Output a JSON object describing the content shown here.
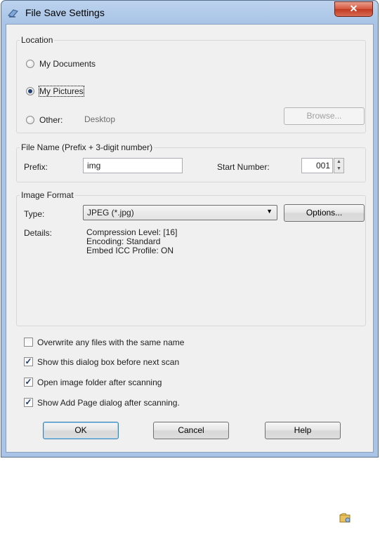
{
  "window": {
    "title": "File Save Settings",
    "close_label": "✕"
  },
  "location": {
    "group_label": "Location",
    "options": [
      {
        "label": "My Documents",
        "checked": false
      },
      {
        "label": "My Pictures",
        "checked": true
      },
      {
        "label": "Other:",
        "checked": false
      }
    ],
    "other_path": "Desktop",
    "browse_label": "Browse..."
  },
  "file_name": {
    "group_label": "File Name (Prefix + 3-digit number)",
    "prefix_label": "Prefix:",
    "prefix_value": "img",
    "start_number_label": "Start Number:",
    "start_number_value": "001"
  },
  "image_format": {
    "group_label": "Image Format",
    "type_label": "Type:",
    "type_value": "JPEG (*.jpg)",
    "options_label": "Options...",
    "details_label": "Details:",
    "details_lines": [
      "Compression Level: [16]",
      "Encoding: Standard",
      "Embed ICC Profile: ON"
    ]
  },
  "checkboxes": [
    {
      "label": "Overwrite any files with the same name",
      "checked": false
    },
    {
      "label": "Show this dialog box before next scan",
      "checked": true
    },
    {
      "label": "Open image folder after scanning",
      "checked": true
    },
    {
      "label": "Show Add Page dialog after scanning.",
      "checked": true
    }
  ],
  "buttons": {
    "ok": "OK",
    "cancel": "Cancel",
    "help": "Help"
  },
  "icons": {
    "app": "scanner-app-icon",
    "corner": "folder-icon"
  },
  "colors": {
    "title_bar": "#a9c4e6",
    "close_button": "#c13a22",
    "dialog_background": "#f0f0f0"
  }
}
